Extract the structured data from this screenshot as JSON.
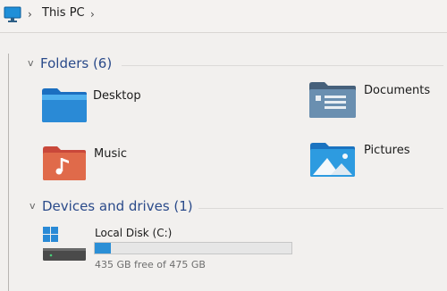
{
  "breadcrumb": {
    "items": [
      "This PC"
    ],
    "separator": "›"
  },
  "folders_group": {
    "title": "Folders (6)",
    "items": [
      {
        "label": "Desktop",
        "icon": "desktop-folder-icon",
        "color": "#2a8ad6"
      },
      {
        "label": "Documents",
        "icon": "documents-folder-icon",
        "color": "#6a8fb0"
      },
      {
        "label": "Music",
        "icon": "music-folder-icon",
        "color": "#e06a4a"
      },
      {
        "label": "Pictures",
        "icon": "pictures-folder-icon",
        "color": "#2d9be0"
      }
    ]
  },
  "drives_group": {
    "title": "Devices and drives (1)",
    "drives": [
      {
        "label": "Local Disk (C:)",
        "free_text": "435 GB free of 475 GB",
        "used_fraction": 0.084
      }
    ]
  },
  "colors": {
    "accent": "#2b8fd6",
    "group_header": "#2a4a8a"
  }
}
